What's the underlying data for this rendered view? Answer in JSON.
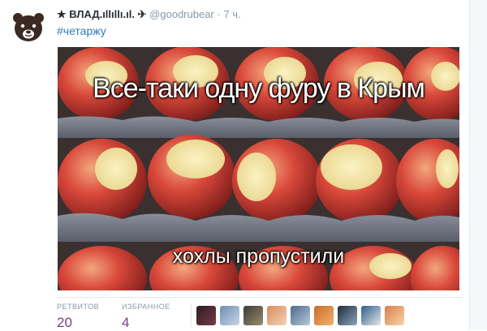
{
  "tweet": {
    "author_name": "★ ВЛАД.ıllıllı.ıl. ✈",
    "separator": "·",
    "handle": "@goodrubear",
    "time": "7 ч.",
    "hashtag": "#четаржу",
    "avatar_icon": "bear-face-icon"
  },
  "photo": {
    "caption_top": "Все-таки одну фуру в Крым",
    "caption_bottom": "хохлы пропустили"
  },
  "stats": {
    "retweets_label": "РЕТВИТОВ",
    "retweets_count": "20",
    "favorites_label": "ИЗБРАННОЕ",
    "favorites_count": "4"
  },
  "colors": {
    "link": "#2b7bb9",
    "count": "#7e3b8c",
    "muted": "#8899a6"
  }
}
